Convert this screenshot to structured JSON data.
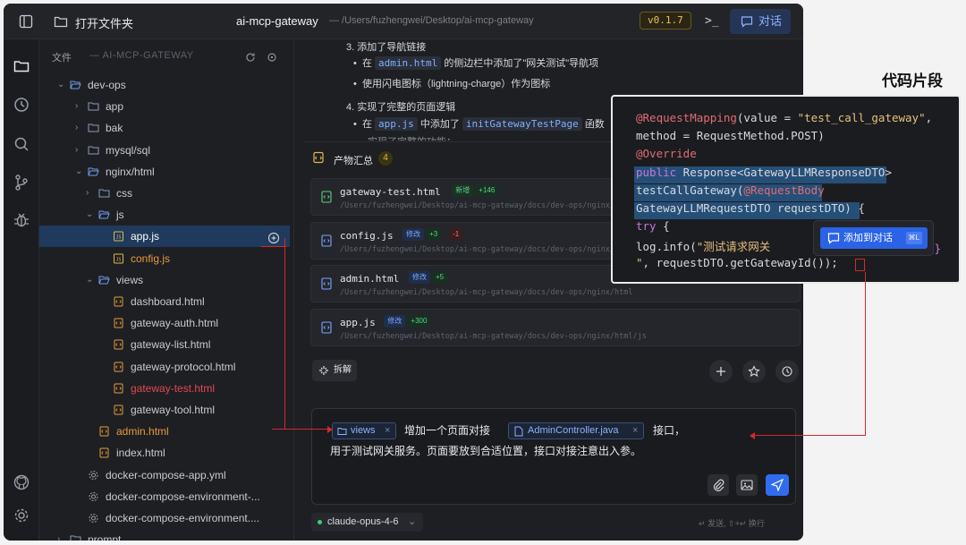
{
  "titlebar": {
    "open_folder": "打开文件夹",
    "project": "ai-mcp-gateway",
    "path": "— /Users/fuzhengwei/Desktop/ai-mcp-gateway",
    "version": "v0.1.7",
    "terminal": ">_",
    "chat": "对话"
  },
  "explorer": {
    "header": "文件",
    "project": "— AI-MCP-GATEWAY",
    "tree": [
      {
        "label": "dev-ops",
        "depth": 0,
        "type": "folder",
        "open": true
      },
      {
        "label": "app",
        "depth": 1,
        "type": "folder"
      },
      {
        "label": "bak",
        "depth": 1,
        "type": "folder"
      },
      {
        "label": "mysql/sql",
        "depth": 1,
        "type": "folder"
      },
      {
        "label": "nginx/html",
        "depth": 1,
        "type": "folder",
        "open": true
      },
      {
        "label": "css",
        "depth": 2,
        "type": "folder"
      },
      {
        "label": "js",
        "depth": 2,
        "type": "folder",
        "open": true
      },
      {
        "label": "app.js",
        "depth": 3,
        "type": "js",
        "selected": true
      },
      {
        "label": "config.js",
        "depth": 3,
        "type": "js",
        "color": "orange"
      },
      {
        "label": "views",
        "depth": 2,
        "type": "folder",
        "open": true
      },
      {
        "label": "dashboard.html",
        "depth": 3,
        "type": "html"
      },
      {
        "label": "gateway-auth.html",
        "depth": 3,
        "type": "html"
      },
      {
        "label": "gateway-list.html",
        "depth": 3,
        "type": "html"
      },
      {
        "label": "gateway-protocol.html",
        "depth": 3,
        "type": "html"
      },
      {
        "label": "gateway-test.html",
        "depth": 3,
        "type": "html",
        "color": "red"
      },
      {
        "label": "gateway-tool.html",
        "depth": 3,
        "type": "html"
      },
      {
        "label": "admin.html",
        "depth": 2,
        "type": "html",
        "color": "orange"
      },
      {
        "label": "index.html",
        "depth": 2,
        "type": "html"
      },
      {
        "label": "docker-compose-app.yml",
        "depth": 1,
        "type": "gear"
      },
      {
        "label": "docker-compose-environment-...",
        "depth": 1,
        "type": "gear"
      },
      {
        "label": "docker-compose-environment....",
        "depth": 1,
        "type": "gear"
      },
      {
        "label": "prompt",
        "depth": 0,
        "type": "folder"
      }
    ]
  },
  "message": {
    "step3": "3. 添加了导航链接",
    "bullet3a_pre": "在",
    "bullet3a_code": "admin.html",
    "bullet3a_post": "的侧边栏中添加了\"网关测试\"导航项",
    "bullet3b": "使用闪电图标（lightning-charge）作为图标",
    "step4": "4. 实现了完整的页面逻辑",
    "bullet4a_pre": "在",
    "bullet4a_code": "app.js",
    "bullet4a_mid": "中添加了",
    "bullet4a_code2": "initGatewayTestPage",
    "bullet4a_post": "函数",
    "bullet4b": "实现了完整的功能："
  },
  "artifacts": {
    "title": "产物汇总",
    "count": "4",
    "items": [
      {
        "name": "gateway-test.html",
        "tag": "新增",
        "tag_type": "new",
        "add": "+146",
        "del": "",
        "path": "/Users/fuzhengwei/Desktop/ai-mcp-gateway/docs/dev-ops/nginx/html/views/gateway-test.html"
      },
      {
        "name": "config.js",
        "tag": "修改",
        "tag_type": "mod",
        "add": "+3",
        "del": "-1",
        "path": "/Users/fuzhengwei/Desktop/ai-mcp-gateway/docs/dev-ops/nginx/html/js/config.js"
      },
      {
        "name": "admin.html",
        "tag": "修改",
        "tag_type": "mod",
        "add": "+5",
        "del": "",
        "path": "/Users/fuzhengwei/Desktop/ai-mcp-gateway/docs/dev-ops/nginx/html"
      },
      {
        "name": "app.js",
        "tag": "修改",
        "tag_type": "mod",
        "add": "+300",
        "del": "",
        "path": "/Users/fuzhengwei/Desktop/ai-mcp-gateway/docs/dev-ops/nginx/html/js"
      }
    ]
  },
  "toolbar": {
    "split": "拆解"
  },
  "input": {
    "chip1": "views",
    "text1": "增加一个页面对接",
    "chip2": "AdminController.java",
    "text2": "接口，",
    "line2": "用于测试网关服务。页面要放到合适位置，接口对接注意出入参。"
  },
  "footer": {
    "model": "claude-opus-4-6",
    "hint": "↵ 发送, ⇧+↵ 换行"
  },
  "snippet": {
    "title": "代码片段",
    "lines": [
      "@RequestMapping(value = \"test_call_gateway\",",
      "method = RequestMethod.POST)",
      "@Override",
      "public Response<GatewayLLMResponseDTO>",
      "testCallGateway(@RequestBody",
      "GatewayLLMRequestDTO requestDTO) {",
      "    try {",
      "        log.info(\"测试请求网关",
      "\", requestDTO.getGatewayId());"
    ],
    "add_button": "添加到对话",
    "shortcut": "⌘L"
  }
}
